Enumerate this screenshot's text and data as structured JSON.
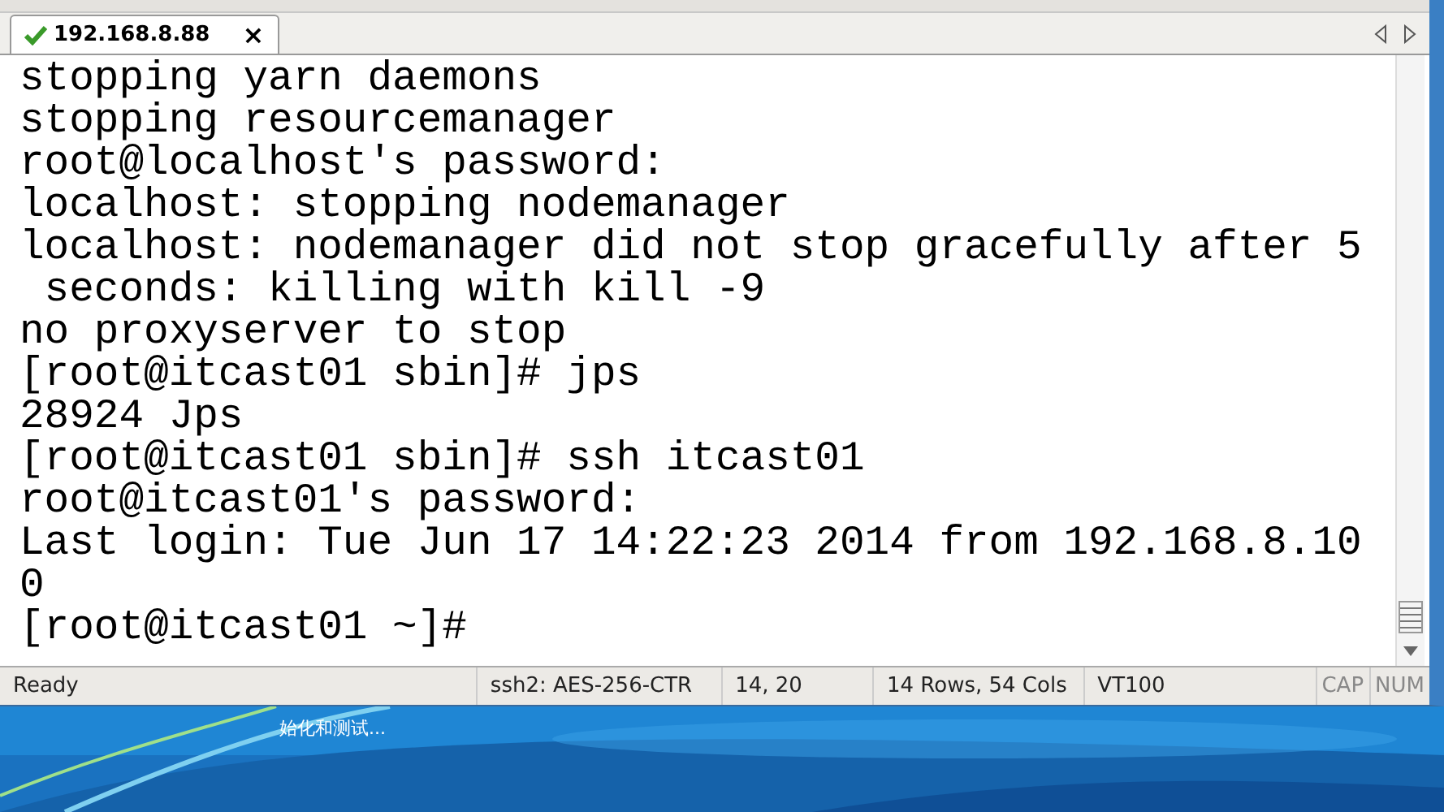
{
  "tab": {
    "title": "192.168.8.88",
    "close": "×",
    "connected": true
  },
  "terminal": {
    "lines": [
      "stopping yarn daemons",
      "stopping resourcemanager",
      "root@localhost's password:",
      "localhost: stopping nodemanager",
      "localhost: nodemanager did not stop gracefully after 5",
      " seconds: killing with kill -9",
      "no proxyserver to stop",
      "[root@itcast01 sbin]# jps",
      "28924 Jps",
      "[root@itcast01 sbin]# ssh itcast01",
      "root@itcast01's password:",
      "Last login: Tue Jun 17 14:22:23 2014 from 192.168.8.10",
      "0",
      "[root@itcast01 ~]#"
    ]
  },
  "status_bar": {
    "fields": [
      "Ready",
      "ssh2: AES-256-CTR",
      "14,  20",
      "14 Rows, 54 Cols",
      "VT100"
    ],
    "cap": "CAP",
    "num": "NUM"
  },
  "desktop": {
    "kind": "picture",
    "subtitle": "始化和测试..."
  }
}
